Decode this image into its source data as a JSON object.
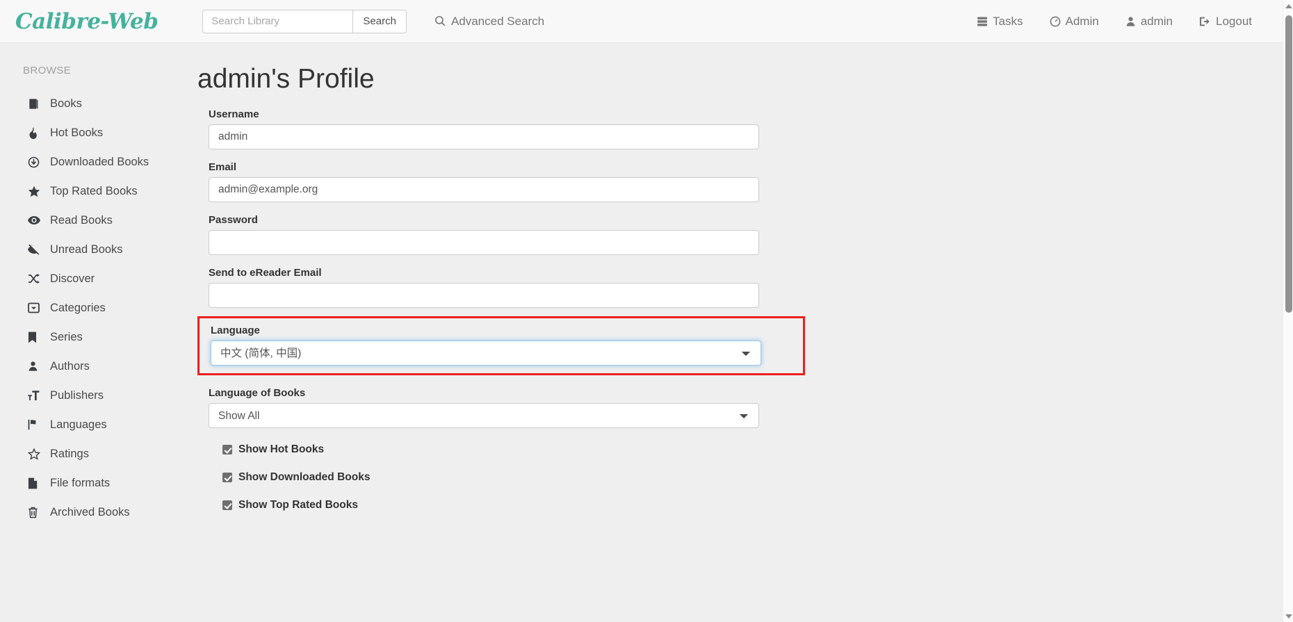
{
  "header": {
    "brand": "Calibre-Web",
    "search": {
      "placeholder": "Search Library",
      "value": "",
      "button_label": "Search"
    },
    "advanced_search_label": "Advanced Search",
    "nav": [
      {
        "label": "Tasks",
        "icon": "tasks-icon"
      },
      {
        "label": "Admin",
        "icon": "dashboard-icon"
      },
      {
        "label": "admin",
        "icon": "user-icon"
      },
      {
        "label": "Logout",
        "icon": "logout-icon"
      }
    ]
  },
  "sidebar": {
    "section_label": "BROWSE",
    "items": [
      {
        "label": "Books",
        "icon": "book-icon"
      },
      {
        "label": "Hot Books",
        "icon": "fire-icon"
      },
      {
        "label": "Downloaded Books",
        "icon": "download-circle-icon"
      },
      {
        "label": "Top Rated Books",
        "icon": "star-filled-icon"
      },
      {
        "label": "Read Books",
        "icon": "eye-icon"
      },
      {
        "label": "Unread Books",
        "icon": "eye-slash-icon"
      },
      {
        "label": "Discover",
        "icon": "shuffle-icon"
      },
      {
        "label": "Categories",
        "icon": "inbox-icon"
      },
      {
        "label": "Series",
        "icon": "bookmark-icon"
      },
      {
        "label": "Authors",
        "icon": "user-icon"
      },
      {
        "label": "Publishers",
        "icon": "text-height-icon"
      },
      {
        "label": "Languages",
        "icon": "flag-icon"
      },
      {
        "label": "Ratings",
        "icon": "star-outline-icon"
      },
      {
        "label": "File formats",
        "icon": "file-icon"
      },
      {
        "label": "Archived Books",
        "icon": "trash-icon"
      }
    ]
  },
  "main": {
    "title": "admin's Profile",
    "fields": {
      "username": {
        "label": "Username",
        "value": "admin"
      },
      "email": {
        "label": "Email",
        "value": "admin@example.org"
      },
      "password": {
        "label": "Password",
        "value": ""
      },
      "ereader_email": {
        "label": "Send to eReader Email",
        "value": ""
      },
      "language": {
        "label": "Language",
        "value": "中文 (简体, 中国)"
      },
      "language_of_books": {
        "label": "Language of Books",
        "value": "Show All"
      }
    },
    "checkboxes": [
      {
        "label": "Show Hot Books",
        "checked": true
      },
      {
        "label": "Show Downloaded Books",
        "checked": true
      },
      {
        "label": "Show Top Rated Books",
        "checked": true
      }
    ]
  },
  "colors": {
    "brand": "#45b29d",
    "highlight": "#ec2020",
    "focus_border": "#9ec9e8",
    "page_bg": "#efefef"
  }
}
